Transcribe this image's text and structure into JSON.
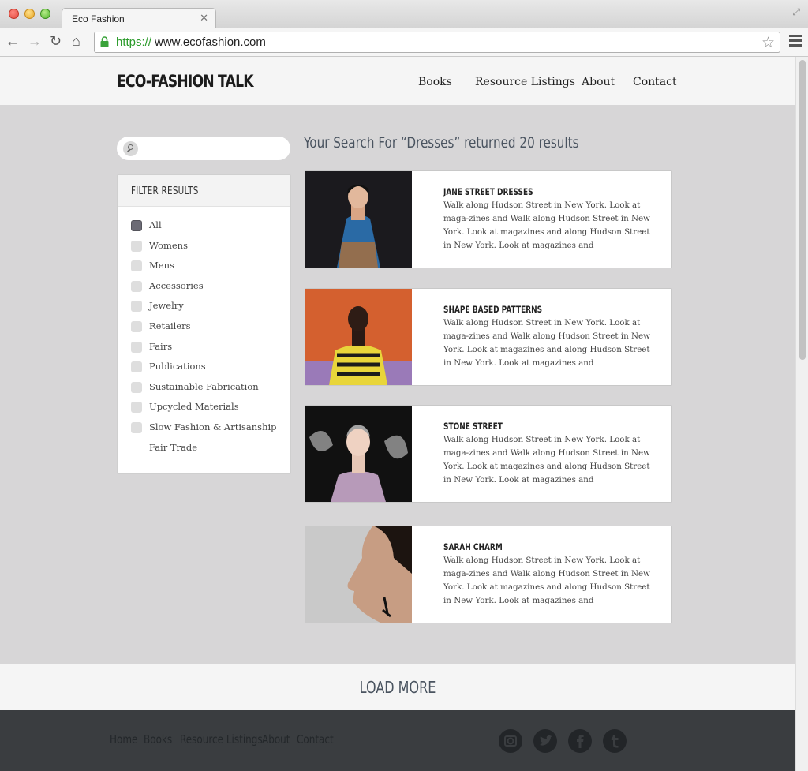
{
  "browser": {
    "tab_title": "Eco Fashion",
    "url_scheme": "https://",
    "url_host": "www.ecofashion.com"
  },
  "header": {
    "logo": "ECO-FASHION TALK",
    "nav": [
      "Books",
      "Resource Listings",
      "About",
      "Contact"
    ]
  },
  "search": {
    "value": "",
    "results_title": "Your Search For “Dresses” returned 20 results"
  },
  "filter": {
    "title": "FILTER RESULTS",
    "items": [
      {
        "label": "All",
        "checked": true
      },
      {
        "label": "Womens",
        "checked": false
      },
      {
        "label": "Mens",
        "checked": false
      },
      {
        "label": "Accessories",
        "checked": false
      },
      {
        "label": "Jewelry",
        "checked": false
      },
      {
        "label": "Retailers",
        "checked": false
      },
      {
        "label": "Fairs",
        "checked": false
      },
      {
        "label": "Publications",
        "checked": false
      },
      {
        "label": "Sustainable Fabrication",
        "checked": false
      },
      {
        "label": "Upcycled Materials",
        "checked": false
      },
      {
        "label": "Slow Fashion & Artisanship",
        "checked": false
      },
      {
        "label": "Fair Trade",
        "checked": false
      }
    ]
  },
  "results": [
    {
      "title": "JANE STREET DRESSES",
      "desc": "Walk along Hudson Street in New York. Look at maga-zines and Walk along Hudson Street in New York. Look at magazines and  along Hudson Street in New York. Look at magazines and"
    },
    {
      "title": "SHAPE BASED PATTERNS",
      "desc": "Walk along Hudson Street in New York. Look at maga-zines and Walk along Hudson Street in New York. Look at magazines and  along Hudson Street in New York. Look at magazines and"
    },
    {
      "title": "STONE STREET",
      "desc": "Walk along Hudson Street in New York. Look at maga-zines and Walk along Hudson Street in New York. Look at magazines and  along Hudson Street in New York. Look at magazines and"
    },
    {
      "title": "SARAH CHARM",
      "desc": "Walk along Hudson Street in New York. Look at maga-zines and Walk along Hudson Street in New York. Look at magazines and  along Hudson Street in New York. Look at magazines and"
    }
  ],
  "load_more": "LOAD MORE",
  "footer": {
    "links": [
      "Home",
      "Books",
      "Resource Listings",
      "About",
      "Contact"
    ],
    "social_icons": [
      "instagram-icon",
      "twitter-icon",
      "facebook-icon",
      "tumblr-icon"
    ]
  },
  "colors": {
    "page_bg": "#d7d6d7",
    "header_bg": "#f5f5f5",
    "footer_bg": "#3a3d40",
    "title_text": "#4a5460"
  }
}
